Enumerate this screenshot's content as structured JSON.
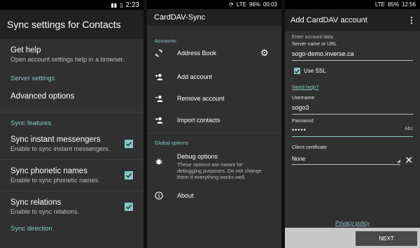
{
  "phone1": {
    "status_time": "2:23",
    "title": "Sync settings for Contacts",
    "get_help_title": "Get help",
    "get_help_summary": "Open account settings help in a browser.",
    "server_settings_category": "Server settings",
    "advanced_options": "Advanced options",
    "sync_features_category": "Sync features",
    "sync_im_title": "Sync instant messengers",
    "sync_im_summary": "Enable to sync instant messengers.",
    "sync_phonetic_title": "Sync phonetic names",
    "sync_phonetic_summary": "Enable to sync phonetic names.",
    "sync_relations_title": "Sync relations",
    "sync_relations_summary": "Enable to sync relations.",
    "sync_direction_category": "Sync direction"
  },
  "phone2": {
    "status_lte": "LTE",
    "status_battery": "96%",
    "status_time": "00:03",
    "title": "CardDAV-Sync",
    "accounts_category": "Accounts",
    "address_book": "Address Book",
    "add_account": "Add account",
    "remove_account": "Remove account",
    "import_contacts": "Import contacts",
    "global_options_category": "Global options",
    "debug_options": "Debug options",
    "debug_summary": "These options are meant for debugging purposes. Do not change them if everything works well.",
    "about": "About"
  },
  "phone3": {
    "status_lte": "LTE",
    "status_battery": "85%",
    "status_time": "12:56",
    "title": "Add CardDAV account",
    "enter_account_data": "Enter account data",
    "server_label": "Server name or URL",
    "server_value": "sogo-demo.inverse.ca",
    "use_ssl": "Use SSL",
    "need_help": "Need help?",
    "username_label": "Username",
    "username_value": "sogo3",
    "password_label": "Password",
    "password_value": "•••••",
    "keyboard_hint": "Abc",
    "client_cert_label": "Client certificate",
    "client_cert_value": "None",
    "privacy_policy": "Privacy policy",
    "next_button": "NEXT"
  },
  "colors": {
    "accent": "#80cbc4",
    "background": "#303030",
    "appbar": "#212121"
  }
}
